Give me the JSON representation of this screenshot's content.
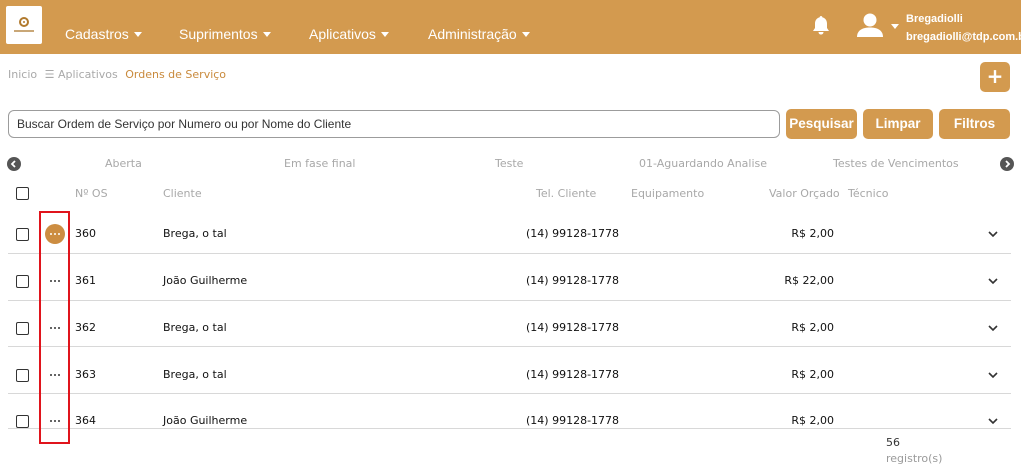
{
  "navbar": {
    "menu": [
      {
        "label": "Cadastros"
      },
      {
        "label": "Suprimentos"
      },
      {
        "label": "Aplicativos"
      },
      {
        "label": "Administração"
      }
    ],
    "user_name": "Bregadiolli",
    "user_email": "bregadiolli@tdp.com.br",
    "color": "#d39a4f"
  },
  "breadcrumb": {
    "home": "Inicio",
    "section": "Aplicativos",
    "current": "Ordens de Serviço"
  },
  "add_button": {
    "label": "+"
  },
  "search": {
    "placeholder": "Buscar Ordem de Serviço por Numero ou por Nome do Cliente",
    "value": ""
  },
  "buttons": {
    "search": "Pesquisar",
    "clear": "Limpar",
    "filters": "Filtros"
  },
  "status_tabs": [
    "Aberta",
    "Em fase final",
    "Teste",
    "01-Aguardando Analise",
    "Testes de Vencimentos"
  ],
  "table": {
    "columns": {
      "os_number": "Nº OS",
      "client": "Cliente",
      "phone": "Tel. Cliente",
      "equipment": "Equipamento",
      "value": "Valor Orçado",
      "technician": "Técnico"
    },
    "rows": [
      {
        "os": "360",
        "client": "Brega, o tal",
        "phone": "(14) 99128-1778",
        "equipment": "",
        "value": "R$ 2,00",
        "technician": ""
      },
      {
        "os": "361",
        "client": "João Guilherme",
        "phone": "(14) 99128-1778",
        "equipment": "",
        "value": "R$ 22,00",
        "technician": ""
      },
      {
        "os": "362",
        "client": "Brega, o tal",
        "phone": "(14) 99128-1778",
        "equipment": "",
        "value": "R$ 2,00",
        "technician": ""
      },
      {
        "os": "363",
        "client": "Brega, o tal",
        "phone": "(14) 99128-1778",
        "equipment": "",
        "value": "R$ 2,00",
        "technician": ""
      },
      {
        "os": "364",
        "client": "João Guilherme",
        "phone": "(14) 99128-1778",
        "equipment": "",
        "value": "R$ 2,00",
        "technician": ""
      }
    ]
  },
  "footer": {
    "total": "56",
    "total_label": "registro(s)"
  },
  "icons": [
    "bell-icon",
    "user-icon",
    "menu-lines-icon",
    "plus-icon",
    "arrow-left-circle-icon",
    "arrow-right-circle-icon",
    "more-dots-icon",
    "chevron-down-icon"
  ],
  "accent_color": "#d39a4f",
  "highlight_color": "#e0141c"
}
